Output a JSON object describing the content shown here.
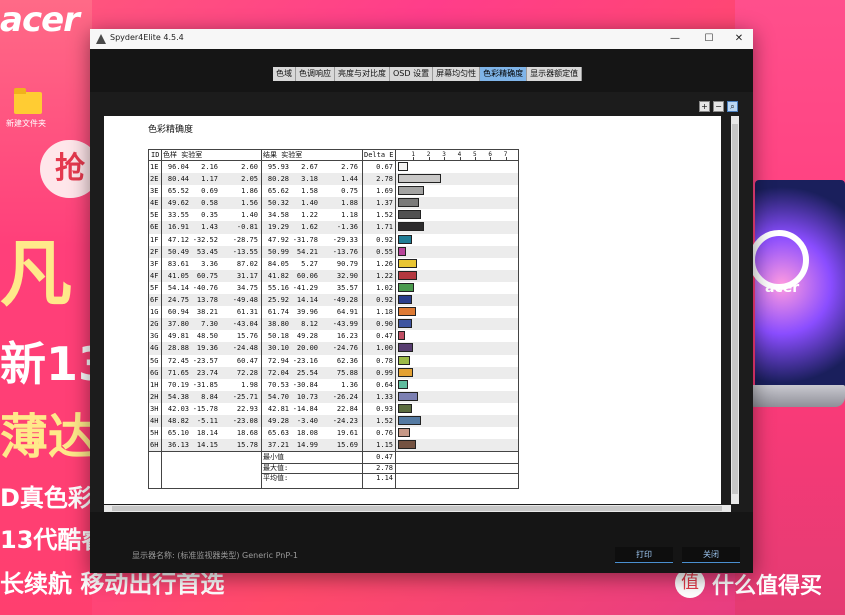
{
  "desktop": {
    "brand_logo": "acer",
    "folder_label": "新建文件夹",
    "promo": [
      "抢",
      "凡",
      "新13代",
      "薄达人",
      "D真色彩",
      "13代酷睿",
      "长续航 移动出行首选"
    ],
    "laptop_logo": "acer",
    "watermark": "什么值得买"
  },
  "window": {
    "title": "Spyder4Elite 4.5.4",
    "controls": [
      "—",
      "☐",
      "✕"
    ],
    "tabs": [
      {
        "label": "色域",
        "active": false
      },
      {
        "label": "色调响应",
        "active": false
      },
      {
        "label": "亮度与对比度",
        "active": false
      },
      {
        "label": "OSD 设置",
        "active": false
      },
      {
        "label": "屏幕均匀性",
        "active": false
      },
      {
        "label": "色彩精确度",
        "active": true
      },
      {
        "label": "显示器额定值",
        "active": false
      }
    ],
    "zoom_icons": [
      "zoom-in-icon",
      "zoom-out-icon",
      "zoom-fit-icon"
    ],
    "footer": {
      "monitor_label": "显示器名称: (标准监视器类型) Generic PnP-1",
      "print_button": "打印",
      "close_button": "关闭"
    }
  },
  "report": {
    "title": "色彩精确度",
    "headers": {
      "id": "ID",
      "sample": "色样 实验室",
      "result": "结果 实验室",
      "delta": "Delta E"
    },
    "scale_ticks": [
      "1",
      "2",
      "3",
      "4",
      "5",
      "6",
      "7"
    ],
    "rows": [
      {
        "id": "1E",
        "sample": [
          "96.04",
          "2.16",
          "2.60"
        ],
        "result": [
          "95.93",
          "2.67",
          "2.76"
        ],
        "delta": "0.67",
        "color": "#f4f3f2"
      },
      {
        "id": "2E",
        "sample": [
          "80.44",
          "1.17",
          "2.05"
        ],
        "result": [
          "80.28",
          "3.18",
          "1.44"
        ],
        "delta": "2.78",
        "color": "#c9c8c7"
      },
      {
        "id": "3E",
        "sample": [
          "65.52",
          "0.69",
          "1.86"
        ],
        "result": [
          "65.62",
          "1.58",
          "0.75"
        ],
        "delta": "1.69",
        "color": "#a3a3a2"
      },
      {
        "id": "4E",
        "sample": [
          "49.62",
          "0.58",
          "1.56"
        ],
        "result": [
          "50.32",
          "1.40",
          "1.88"
        ],
        "delta": "1.37",
        "color": "#7a7a79"
      },
      {
        "id": "5E",
        "sample": [
          "33.55",
          "0.35",
          "1.40"
        ],
        "result": [
          "34.58",
          "1.22",
          "1.18"
        ],
        "delta": "1.52",
        "color": "#505050"
      },
      {
        "id": "6E",
        "sample": [
          "16.91",
          "1.43",
          "-0.81"
        ],
        "result": [
          "19.29",
          "1.62",
          "-1.36"
        ],
        "delta": "1.71",
        "color": "#2c2b2c"
      },
      {
        "id": "1F",
        "sample": [
          "47.12",
          "-32.52",
          "-28.75"
        ],
        "result": [
          "47.92",
          "-31.78",
          "-29.33"
        ],
        "delta": "0.92",
        "color": "#1f7d96"
      },
      {
        "id": "2F",
        "sample": [
          "50.49",
          "53.45",
          "-13.55"
        ],
        "result": [
          "50.99",
          "54.21",
          "-13.76"
        ],
        "delta": "0.55",
        "color": "#b8449a"
      },
      {
        "id": "3F",
        "sample": [
          "83.61",
          "3.36",
          "87.02"
        ],
        "result": [
          "84.05",
          "5.27",
          "90.79"
        ],
        "delta": "1.26",
        "color": "#e9c532"
      },
      {
        "id": "4F",
        "sample": [
          "41.05",
          "60.75",
          "31.17"
        ],
        "result": [
          "41.82",
          "60.06",
          "32.90"
        ],
        "delta": "1.22",
        "color": "#b4373f"
      },
      {
        "id": "5F",
        "sample": [
          "54.14",
          "-40.76",
          "34.75"
        ],
        "result": [
          "55.16",
          "-41.29",
          "35.57"
        ],
        "delta": "1.02",
        "color": "#4a9a4d"
      },
      {
        "id": "6F",
        "sample": [
          "24.75",
          "13.78",
          "-49.48"
        ],
        "result": [
          "25.92",
          "14.14",
          "-49.28"
        ],
        "delta": "0.92",
        "color": "#2a3d8c"
      },
      {
        "id": "1G",
        "sample": [
          "60.94",
          "38.21",
          "61.31"
        ],
        "result": [
          "61.74",
          "39.96",
          "64.91"
        ],
        "delta": "1.18",
        "color": "#de7a34"
      },
      {
        "id": "2G",
        "sample": [
          "37.80",
          "7.30",
          "-43.04"
        ],
        "result": [
          "38.80",
          "8.12",
          "-43.99"
        ],
        "delta": "0.90",
        "color": "#3e54a0"
      },
      {
        "id": "3G",
        "sample": [
          "49.81",
          "48.50",
          "15.76"
        ],
        "result": [
          "50.18",
          "49.28",
          "16.23"
        ],
        "delta": "0.47",
        "color": "#c04e63"
      },
      {
        "id": "4G",
        "sample": [
          "28.88",
          "19.36",
          "-24.48"
        ],
        "result": [
          "30.10",
          "20.00",
          "-24.76"
        ],
        "delta": "1.00",
        "color": "#583d70"
      },
      {
        "id": "5G",
        "sample": [
          "72.45",
          "-23.57",
          "60.47"
        ],
        "result": [
          "72.94",
          "-23.16",
          "62.36"
        ],
        "delta": "0.78",
        "color": "#9dbb48"
      },
      {
        "id": "6G",
        "sample": [
          "71.65",
          "23.74",
          "72.28"
        ],
        "result": [
          "72.04",
          "25.54",
          "75.88"
        ],
        "delta": "0.99",
        "color": "#e3a133"
      },
      {
        "id": "1H",
        "sample": [
          "70.19",
          "-31.85",
          "1.98"
        ],
        "result": [
          "70.53",
          "-30.84",
          "1.36"
        ],
        "delta": "0.64",
        "color": "#5fbc9e"
      },
      {
        "id": "2H",
        "sample": [
          "54.38",
          "8.84",
          "-25.71"
        ],
        "result": [
          "54.70",
          "10.73",
          "-26.24"
        ],
        "delta": "1.33",
        "color": "#7c80b3"
      },
      {
        "id": "3H",
        "sample": [
          "42.03",
          "-15.78",
          "22.93"
        ],
        "result": [
          "42.81",
          "-14.84",
          "22.84"
        ],
        "delta": "0.93",
        "color": "#5a6c3e"
      },
      {
        "id": "4H",
        "sample": [
          "48.82",
          "-5.11",
          "-23.08"
        ],
        "result": [
          "49.28",
          "-3.40",
          "-24.23"
        ],
        "delta": "1.52",
        "color": "#547aa2"
      },
      {
        "id": "5H",
        "sample": [
          "65.10",
          "18.14",
          "18.68"
        ],
        "result": [
          "65.63",
          "18.08",
          "19.61"
        ],
        "delta": "0.76",
        "color": "#c69886"
      },
      {
        "id": "6H",
        "sample": [
          "36.13",
          "14.15",
          "15.78"
        ],
        "result": [
          "37.21",
          "14.99",
          "15.69"
        ],
        "delta": "1.15",
        "color": "#745241"
      }
    ],
    "summary": [
      {
        "label": "最小值",
        "value": "0.47"
      },
      {
        "label": "最大值:",
        "value": "2.78"
      },
      {
        "label": "平均值:",
        "value": "1.14"
      }
    ]
  }
}
